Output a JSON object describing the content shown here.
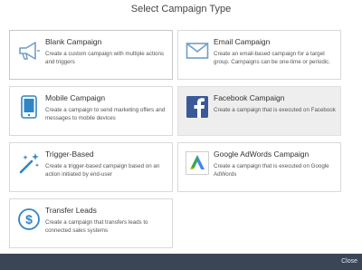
{
  "dialog": {
    "title": "Select Campaign Type",
    "close_label": "Close"
  },
  "colors": {
    "icon_blue": "#2f86c6",
    "icon_outline": "#6f9ec6",
    "footer_bg": "#3a4656",
    "hover_bg": "#eeeeee",
    "facebook_blue": "#3b5998",
    "adwords_blue": "#4285f4",
    "adwords_green": "#34a853",
    "adwords_yellow": "#fbbc05"
  },
  "campaigns": [
    {
      "title": "Blank Campaign",
      "description": "Create a custom campaign with multiple actions and triggers",
      "icon": "megaphone-icon"
    },
    {
      "title": "Email Campaign",
      "description": "Create an email-based campaign for a target group. Campaigns can be one-time or periodic.",
      "icon": "envelope-icon"
    },
    {
      "title": "Mobile Campaign",
      "description": "Create a campaign to send marketing offers and messages to mobile devices",
      "icon": "mobile-device-icon"
    },
    {
      "title": "Facebook Campaign",
      "description": "Create a campaign that is executed on Facebook",
      "icon": "facebook-icon"
    },
    {
      "title": "Trigger-Based",
      "description": "Create a trigger-based campaign based on an action initiated by end-user",
      "icon": "magic-wand-icon"
    },
    {
      "title": "Google AdWords Campaign",
      "description": "Create a campaign that is executed on Google AdWords",
      "icon": "google-adwords-icon"
    },
    {
      "title": "Transfer Leads",
      "description": "Create a campaign that transfers leads to connected sales systems",
      "icon": "dollar-circle-icon"
    }
  ]
}
